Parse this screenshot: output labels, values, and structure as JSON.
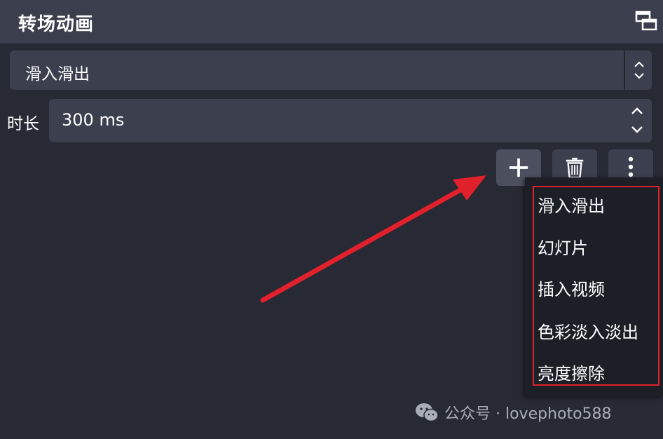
{
  "panel": {
    "title": "转场动画"
  },
  "transition": {
    "selected": "滑入滑出"
  },
  "duration": {
    "label": "时长",
    "value": "300 ms"
  },
  "toolbar": {
    "add_icon": "plus-icon",
    "remove_icon": "trash-icon",
    "more_icon": "more-vertical-icon"
  },
  "menu": {
    "items": [
      "滑入滑出",
      "幻灯片",
      "插入视频",
      "色彩淡入淡出",
      "亮度擦除"
    ]
  },
  "annotation": {
    "arrow_color": "#e0202a",
    "highlight_color": "#e0202a"
  },
  "watermark": {
    "icon": "wechat-icon",
    "text": "公众号 · lovephoto588"
  }
}
